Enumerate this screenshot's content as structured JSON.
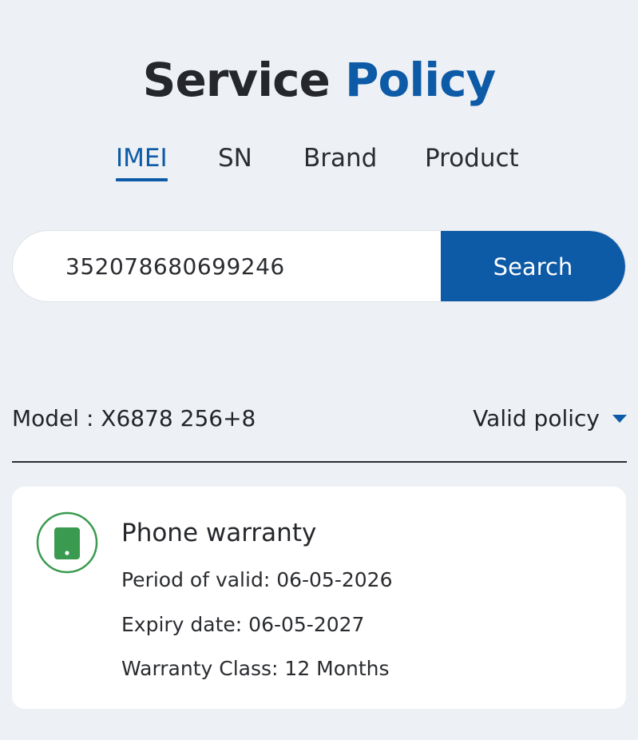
{
  "header": {
    "title_part1": "Service",
    "title_part2": "Policy"
  },
  "tabs": [
    {
      "label": "IMEI",
      "active": true
    },
    {
      "label": "SN",
      "active": false
    },
    {
      "label": "Brand",
      "active": false
    },
    {
      "label": "Product",
      "active": false
    }
  ],
  "search": {
    "value": "352078680699246",
    "button_label": "Search"
  },
  "result": {
    "model_label": "Model : X6878 256+8",
    "policy_filter": "Valid policy",
    "filter_icon": "caret-down-icon"
  },
  "card": {
    "icon": "phone-icon",
    "title": "Phone warranty",
    "period": "Period of valid: 06-05-2026",
    "expiry": "Expiry date: 06-05-2027",
    "warranty_class": "Warranty Class: 12 Months"
  },
  "colors": {
    "accent": "#0d5aa7",
    "background": "#edf0f4",
    "icon_green": "#3a9a4f"
  }
}
